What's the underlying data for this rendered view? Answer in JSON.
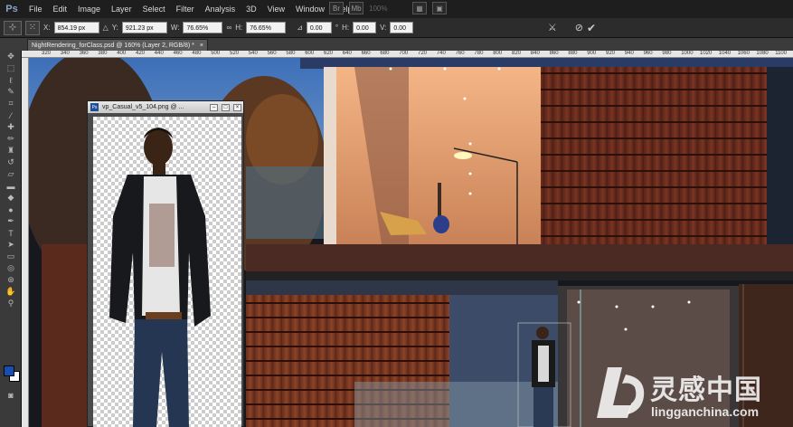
{
  "app": {
    "logo": "Ps"
  },
  "menu": [
    "File",
    "Edit",
    "Image",
    "Layer",
    "Select",
    "Filter",
    "Analysis",
    "3D",
    "View",
    "Window",
    "Help"
  ],
  "menubar_right": {
    "zoom": "100%"
  },
  "options": {
    "x_label": "X:",
    "x_value": "854.19 px",
    "y_label": "Y:",
    "y_value": "921.23 px",
    "w_label": "W:",
    "w_value": "76.65%",
    "h_label": "H:",
    "h_value": "76.65%",
    "angle_value": "0.00",
    "angle_unit": "°",
    "hskew_label": "H:",
    "hskew_value": "0.00",
    "vskew_label": "V:",
    "vskew_value": "0.00"
  },
  "document_tab": {
    "title": "NightRendering_forClass.psd @ 160% (Layer 2, RGB/8) *",
    "close": "×"
  },
  "ruler_ticks": [
    "320",
    "340",
    "360",
    "380",
    "400",
    "420",
    "440",
    "460",
    "480",
    "500",
    "520",
    "540",
    "560",
    "580",
    "600",
    "620",
    "640",
    "660",
    "680",
    "700",
    "720",
    "740",
    "760",
    "780",
    "800",
    "820",
    "840",
    "860",
    "880",
    "900",
    "920",
    "940",
    "960",
    "980",
    "1000",
    "1020",
    "1040",
    "1060",
    "1080",
    "1100"
  ],
  "subwindow": {
    "title": "vp_Casual_v5_104.png @ ..."
  },
  "colors": {
    "foreground": "#1450b4",
    "background": "#ffffff",
    "accent": "#3a7bd5"
  },
  "watermark": {
    "text": "灵感中国",
    "url": "lingganchina.com"
  }
}
